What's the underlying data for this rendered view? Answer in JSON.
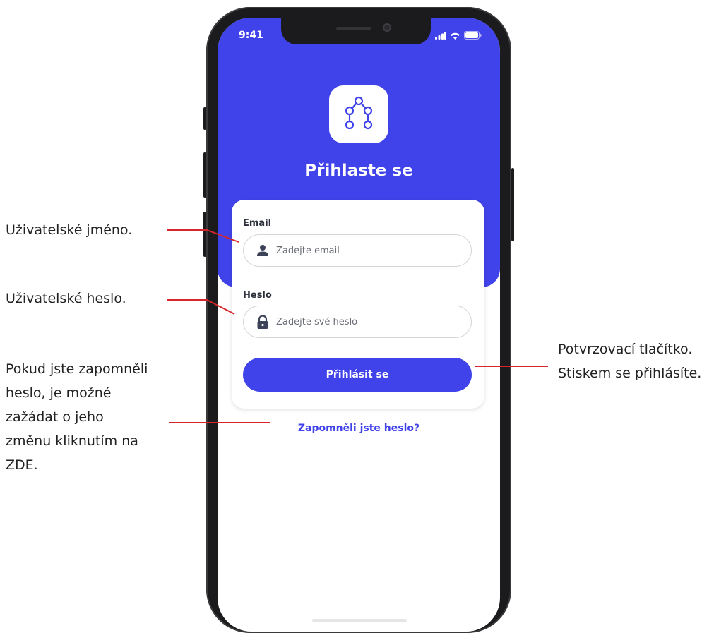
{
  "status_bar": {
    "time": "9:41"
  },
  "app": {
    "logo_icon": "nodes-graph-icon",
    "title": "Přihlaste se",
    "accent_color": "#4143ea"
  },
  "form": {
    "email_label": "Email",
    "email_placeholder": "Zadejte email",
    "email_icon": "user-icon",
    "password_label": "Heslo",
    "password_placeholder": "Zadejte své heslo",
    "password_icon": "lock-icon",
    "submit_label": "Přihlásit se"
  },
  "forgot_link": "Zapomněli jste heslo?",
  "annotations": {
    "username": "Uživatelské jméno.",
    "password": "Uživatelské heslo.",
    "forgot": "Pokud jste zapomněli\nheslo, je možné\nzažádat  o jeho\nzměnu kliknutím na\nZDE.",
    "submit": "Potvrzovací tlačítko.\nStiskem se přihlásíte.",
    "line_color": "#d6262b"
  }
}
